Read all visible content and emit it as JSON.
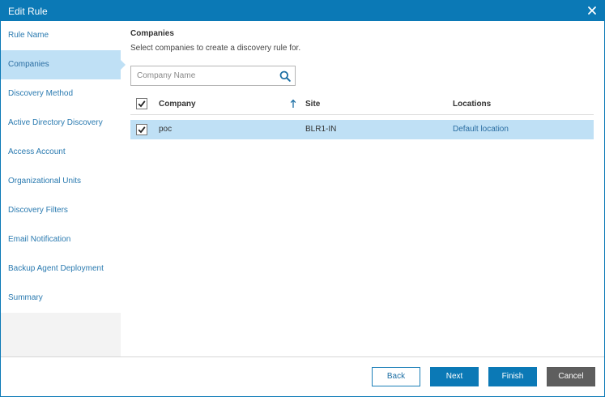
{
  "window": {
    "title": "Edit Rule"
  },
  "sidebar": {
    "items": [
      {
        "label": "Rule Name",
        "active": false
      },
      {
        "label": "Companies",
        "active": true
      },
      {
        "label": "Discovery Method",
        "active": false
      },
      {
        "label": "Active Directory Discovery",
        "active": false
      },
      {
        "label": "Access Account",
        "active": false
      },
      {
        "label": "Organizational Units",
        "active": false
      },
      {
        "label": "Discovery Filters",
        "active": false
      },
      {
        "label": "Email Notification",
        "active": false
      },
      {
        "label": "Backup Agent Deployment",
        "active": false
      },
      {
        "label": "Summary",
        "active": false
      }
    ]
  },
  "main": {
    "heading": "Companies",
    "description": "Select companies to create a discovery rule for.",
    "search": {
      "placeholder": "Company Name",
      "value": ""
    },
    "table": {
      "columns": [
        "Company",
        "Site",
        "Locations"
      ],
      "sort": {
        "column": "Company",
        "direction": "ascending"
      },
      "select_all_checked": true,
      "rows": [
        {
          "checked": true,
          "company": "poc",
          "site": "BLR1-IN",
          "location": "Default location"
        }
      ]
    }
  },
  "footer": {
    "back": "Back",
    "next": "Next",
    "finish": "Finish",
    "cancel": "Cancel"
  },
  "colors": {
    "accent": "#0b79b6",
    "selected_row": "#bfe0f5",
    "link": "#2a6da1",
    "cancel": "#5e5e5e"
  },
  "icons": [
    "close-icon",
    "search-icon",
    "checkmark-icon",
    "sort-ascending-icon"
  ]
}
